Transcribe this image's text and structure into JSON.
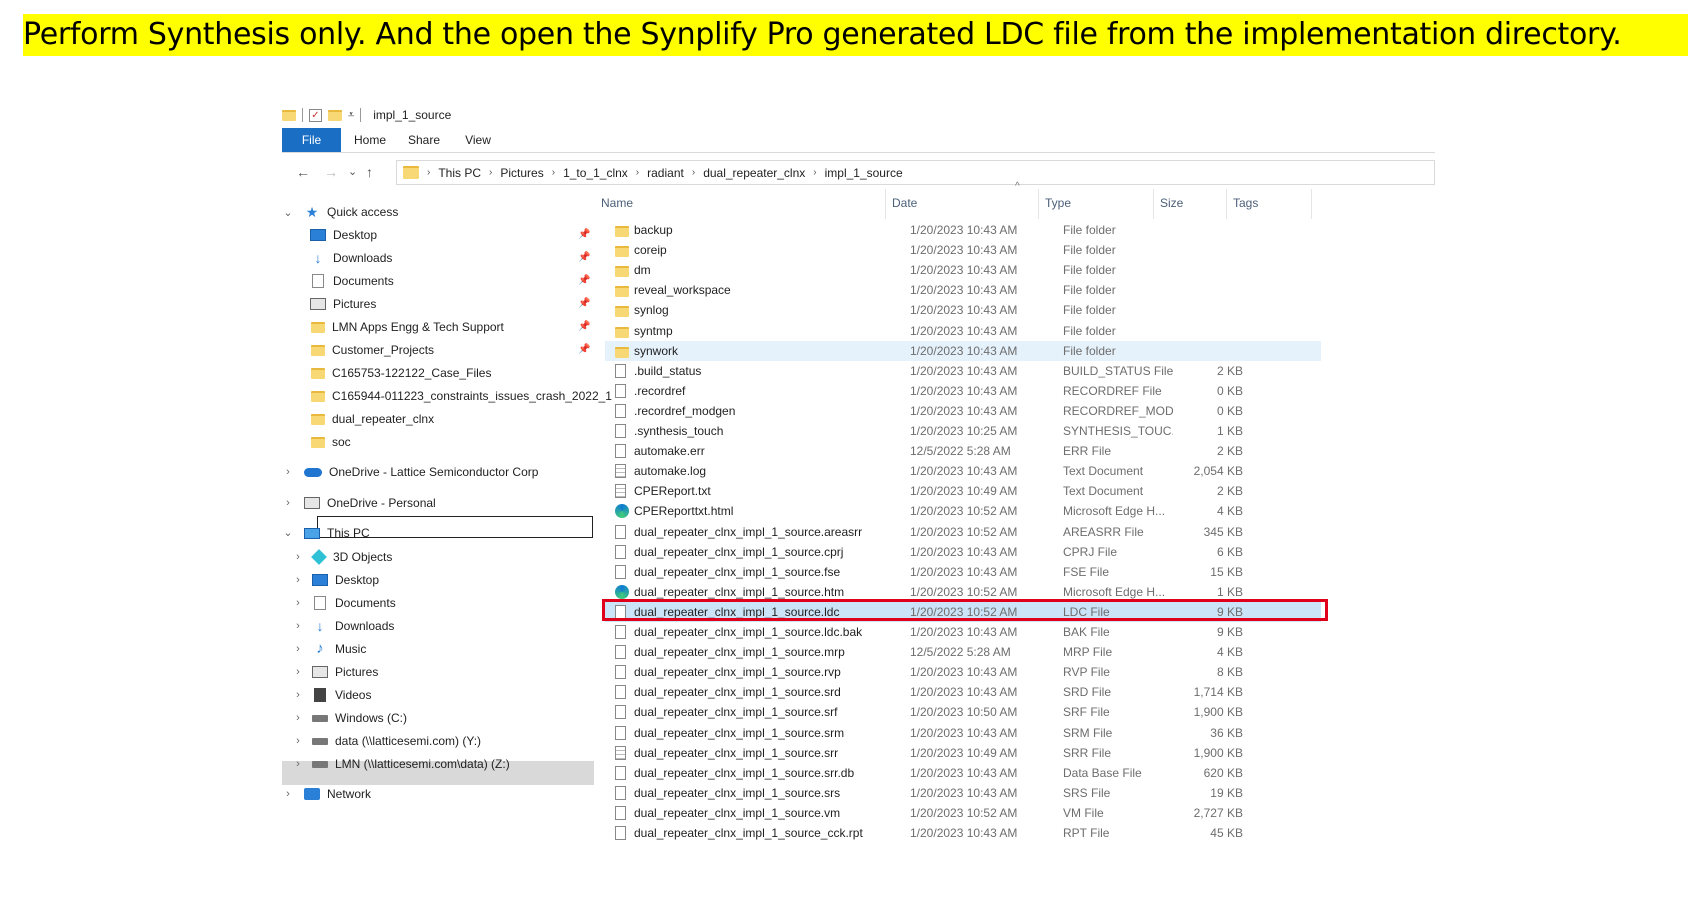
{
  "banner": {
    "text": "Perform Synthesis only. And the open the Synplify Pro generated LDC file from the implementation directory."
  },
  "window": {
    "title": "impl_1_source"
  },
  "ribbon": {
    "tabs": [
      {
        "label": "File"
      },
      {
        "label": "Home"
      },
      {
        "label": "Share"
      },
      {
        "label": "View"
      }
    ]
  },
  "nav": {
    "back": "←",
    "forward": "→",
    "recent": "⌄",
    "up": "↑"
  },
  "address": {
    "crumbs": [
      "This PC",
      "Pictures",
      "1_to_1_clnx",
      "radiant",
      "dual_repeater_clnx",
      "impl_1_source"
    ]
  },
  "tree": {
    "quick_access": "Quick access",
    "quick_items": [
      {
        "label": "Desktop",
        "icon": "desktop-icon",
        "pinned": true
      },
      {
        "label": "Downloads",
        "icon": "download-icon",
        "pinned": true
      },
      {
        "label": "Documents",
        "icon": "documents-icon",
        "pinned": true
      },
      {
        "label": "Pictures",
        "icon": "pictures-icon",
        "pinned": true
      },
      {
        "label": "LMN Apps Engg & Tech Support",
        "icon": "folder-icon",
        "pinned": true
      },
      {
        "label": "Customer_Projects",
        "icon": "folder-icon",
        "pinned": true
      },
      {
        "label": "C165753-122122_Case_Files",
        "icon": "folder-icon",
        "pinned": false
      },
      {
        "label": "C165944-011223_constraints_issues_crash_2022_1",
        "icon": "folder-icon",
        "pinned": false
      },
      {
        "label": "dual_repeater_clnx",
        "icon": "folder-icon",
        "pinned": false
      },
      {
        "label": "soc",
        "icon": "folder-icon",
        "pinned": false
      }
    ],
    "onedrive_corp": "OneDrive - Lattice Semiconductor Corp",
    "onedrive_personal": "OneDrive - Personal",
    "this_pc": "This PC",
    "pc_items": [
      {
        "label": "3D Objects",
        "icon": "3d-objects-icon"
      },
      {
        "label": "Desktop",
        "icon": "desktop-icon"
      },
      {
        "label": "Documents",
        "icon": "documents-icon"
      },
      {
        "label": "Downloads",
        "icon": "download-icon"
      },
      {
        "label": "Music",
        "icon": "music-icon"
      },
      {
        "label": "Pictures",
        "icon": "pictures-icon"
      },
      {
        "label": "Videos",
        "icon": "videos-icon"
      },
      {
        "label": "Windows (C:)",
        "icon": "drive-icon"
      },
      {
        "label": "data (\\\\latticesemi.com) (Y:)",
        "icon": "network-drive-icon"
      },
      {
        "label": "LMN (\\\\latticesemi.com\\data) (Z:)",
        "icon": "network-drive-icon"
      }
    ],
    "network": "Network"
  },
  "columns": {
    "name": "Name",
    "date": "Date",
    "type": "Type",
    "size": "Size",
    "tags": "Tags"
  },
  "files": [
    {
      "name": "backup",
      "date": "1/20/2023 10:43 AM",
      "type": "File folder",
      "size": "",
      "icon": "folder"
    },
    {
      "name": "coreip",
      "date": "1/20/2023 10:43 AM",
      "type": "File folder",
      "size": "",
      "icon": "folder"
    },
    {
      "name": "dm",
      "date": "1/20/2023 10:43 AM",
      "type": "File folder",
      "size": "",
      "icon": "folder"
    },
    {
      "name": "reveal_workspace",
      "date": "1/20/2023 10:43 AM",
      "type": "File folder",
      "size": "",
      "icon": "folder"
    },
    {
      "name": "synlog",
      "date": "1/20/2023 10:43 AM",
      "type": "File folder",
      "size": "",
      "icon": "folder"
    },
    {
      "name": "syntmp",
      "date": "1/20/2023 10:43 AM",
      "type": "File folder",
      "size": "",
      "icon": "folder"
    },
    {
      "name": "synwork",
      "date": "1/20/2023 10:43 AM",
      "type": "File folder",
      "size": "",
      "icon": "folder"
    },
    {
      "name": ".build_status",
      "date": "1/20/2023 10:43 AM",
      "type": "BUILD_STATUS File",
      "size": "2 KB",
      "icon": "file"
    },
    {
      "name": ".recordref",
      "date": "1/20/2023 10:43 AM",
      "type": "RECORDREF File",
      "size": "0 KB",
      "icon": "file"
    },
    {
      "name": ".recordref_modgen",
      "date": "1/20/2023 10:43 AM",
      "type": "RECORDREF_MOD...",
      "size": "0 KB",
      "icon": "file"
    },
    {
      "name": ".synthesis_touch",
      "date": "1/20/2023 10:25 AM",
      "type": "SYNTHESIS_TOUC...",
      "size": "1 KB",
      "icon": "file"
    },
    {
      "name": "automake.err",
      "date": "12/5/2022 5:28 AM",
      "type": "ERR File",
      "size": "2 KB",
      "icon": "file"
    },
    {
      "name": "automake.log",
      "date": "1/20/2023 10:43 AM",
      "type": "Text Document",
      "size": "2,054 KB",
      "icon": "txt"
    },
    {
      "name": "CPEReport.txt",
      "date": "1/20/2023 10:49 AM",
      "type": "Text Document",
      "size": "2 KB",
      "icon": "txt"
    },
    {
      "name": "CPEReporttxt.html",
      "date": "1/20/2023 10:52 AM",
      "type": "Microsoft Edge H...",
      "size": "4 KB",
      "icon": "edge"
    },
    {
      "name": "dual_repeater_clnx_impl_1_source.areasrr",
      "date": "1/20/2023 10:52 AM",
      "type": "AREASRR File",
      "size": "345 KB",
      "icon": "file"
    },
    {
      "name": "dual_repeater_clnx_impl_1_source.cprj",
      "date": "1/20/2023 10:43 AM",
      "type": "CPRJ File",
      "size": "6 KB",
      "icon": "file"
    },
    {
      "name": "dual_repeater_clnx_impl_1_source.fse",
      "date": "1/20/2023 10:43 AM",
      "type": "FSE File",
      "size": "15 KB",
      "icon": "file"
    },
    {
      "name": "dual_repeater_clnx_impl_1_source.htm",
      "date": "1/20/2023 10:52 AM",
      "type": "Microsoft Edge H...",
      "size": "1 KB",
      "icon": "edge"
    },
    {
      "name": "dual_repeater_clnx_impl_1_source.ldc",
      "date": "1/20/2023 10:52 AM",
      "type": "LDC File",
      "size": "9 KB",
      "icon": "file"
    },
    {
      "name": "dual_repeater_clnx_impl_1_source.ldc.bak",
      "date": "1/20/2023 10:43 AM",
      "type": "BAK File",
      "size": "9 KB",
      "icon": "file"
    },
    {
      "name": "dual_repeater_clnx_impl_1_source.mrp",
      "date": "12/5/2022 5:28 AM",
      "type": "MRP File",
      "size": "4 KB",
      "icon": "file"
    },
    {
      "name": "dual_repeater_clnx_impl_1_source.rvp",
      "date": "1/20/2023 10:43 AM",
      "type": "RVP File",
      "size": "8 KB",
      "icon": "file"
    },
    {
      "name": "dual_repeater_clnx_impl_1_source.srd",
      "date": "1/20/2023 10:43 AM",
      "type": "SRD File",
      "size": "1,714 KB",
      "icon": "file"
    },
    {
      "name": "dual_repeater_clnx_impl_1_source.srf",
      "date": "1/20/2023 10:50 AM",
      "type": "SRF File",
      "size": "1,900 KB",
      "icon": "file"
    },
    {
      "name": "dual_repeater_clnx_impl_1_source.srm",
      "date": "1/20/2023 10:43 AM",
      "type": "SRM File",
      "size": "36 KB",
      "icon": "file"
    },
    {
      "name": "dual_repeater_clnx_impl_1_source.srr",
      "date": "1/20/2023 10:49 AM",
      "type": "SRR File",
      "size": "1,900 KB",
      "icon": "txt"
    },
    {
      "name": "dual_repeater_clnx_impl_1_source.srr.db",
      "date": "1/20/2023 10:43 AM",
      "type": "Data Base File",
      "size": "620 KB",
      "icon": "file"
    },
    {
      "name": "dual_repeater_clnx_impl_1_source.srs",
      "date": "1/20/2023 10:43 AM",
      "type": "SRS File",
      "size": "19 KB",
      "icon": "file"
    },
    {
      "name": "dual_repeater_clnx_impl_1_source.vm",
      "date": "1/20/2023 10:52 AM",
      "type": "VM File",
      "size": "2,727 KB",
      "icon": "file"
    },
    {
      "name": "dual_repeater_clnx_impl_1_source_cck.rpt",
      "date": "1/20/2023 10:43 AM",
      "type": "RPT File",
      "size": "45 KB",
      "icon": "file"
    }
  ],
  "accent": "#1a6fc5",
  "highlight_color": "#e0001b"
}
